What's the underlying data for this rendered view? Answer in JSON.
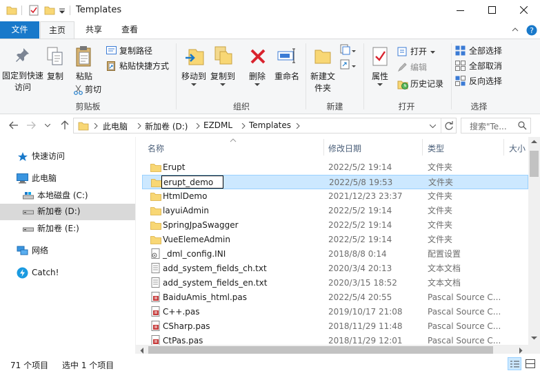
{
  "window": {
    "title": "Templates"
  },
  "menu_tabs": [
    {
      "label": "文件"
    },
    {
      "label": "主页"
    },
    {
      "label": "共享"
    },
    {
      "label": "查看"
    }
  ],
  "ribbon": {
    "clipboard": {
      "pin_label": "固定到快速访问",
      "copy_label": "复制",
      "paste_label": "粘贴",
      "copy_path_label": "复制路径",
      "paste_shortcut_label": "粘贴快捷方式",
      "cut_label": "剪切",
      "group_label": "剪贴板"
    },
    "organize": {
      "move_to_label": "移动到",
      "copy_to_label": "复制到",
      "delete_label": "删除",
      "rename_label": "重命名",
      "group_label": "组织"
    },
    "new": {
      "new_folder_label": "新建文件夹",
      "group_label": "新建"
    },
    "open": {
      "properties_label": "属性",
      "open_label": "打开",
      "edit_label": "编辑",
      "history_label": "历史记录",
      "group_label": "打开"
    },
    "select": {
      "select_all_label": "全部选择",
      "select_none_label": "全部取消",
      "invert_label": "反向选择",
      "group_label": "选择"
    }
  },
  "address": {
    "crumbs": [
      "此电脑",
      "新加卷 (D:)",
      "EZDML",
      "Templates"
    ],
    "search_placeholder": "搜索\"Te..."
  },
  "nav": {
    "quick_access": "快速访问",
    "this_pc": "此电脑",
    "local_disk": "本地磁盘 (C:)",
    "new_volume_d": "新加卷 (D:)",
    "new_volume_e": "新加卷 (E:)",
    "network": "网络",
    "catch": "Catch!"
  },
  "columns": {
    "name": "名称",
    "date": "修改日期",
    "type": "类型",
    "size": "大小"
  },
  "files": [
    {
      "name": "Erupt",
      "date": "2022/5/2 19:14",
      "type": "文件夹",
      "kind": "folder"
    },
    {
      "name": "erupt_demo",
      "date": "2022/5/8 19:53",
      "type": "文件夹",
      "kind": "folder",
      "selected": true
    },
    {
      "name": "HtmlDemo",
      "date": "2021/12/23 23:37",
      "type": "文件夹",
      "kind": "folder"
    },
    {
      "name": "layuiAdmin",
      "date": "2022/5/2 19:14",
      "type": "文件夹",
      "kind": "folder"
    },
    {
      "name": "SpringJpaSwagger",
      "date": "2022/5/2 19:14",
      "type": "文件夹",
      "kind": "folder"
    },
    {
      "name": "VueElemeAdmin",
      "date": "2022/5/2 19:14",
      "type": "文件夹",
      "kind": "folder"
    },
    {
      "name": "_dml_config.INI",
      "date": "2018/8/8 0:14",
      "type": "配置设置",
      "kind": "ini"
    },
    {
      "name": "add_system_fields_ch.txt",
      "date": "2020/3/4 20:13",
      "type": "文本文档",
      "kind": "txt"
    },
    {
      "name": "add_system_fields_en.txt",
      "date": "2020/3/15 18:52",
      "type": "文本文档",
      "kind": "txt"
    },
    {
      "name": "BaiduAmis_html.pas",
      "date": "2022/5/4 20:55",
      "type": "Pascal Source C...",
      "kind": "pas"
    },
    {
      "name": "C++.pas",
      "date": "2019/10/17 21:08",
      "type": "Pascal Source C...",
      "kind": "pas"
    },
    {
      "name": "CSharp.pas",
      "date": "2018/11/29 11:48",
      "type": "Pascal Source C...",
      "kind": "pas"
    },
    {
      "name": "CtPas.pas",
      "date": "2018/11/29 12:01",
      "type": "Pascal Source C...",
      "kind": "pas"
    }
  ],
  "status": {
    "item_count": "71 个项目",
    "selected_count": "选中 1 个项目"
  },
  "colors": {
    "accent": "#1979ca",
    "selection": "#cce8ff",
    "folder": "#f8d775",
    "delete_red": "#d9232e"
  }
}
